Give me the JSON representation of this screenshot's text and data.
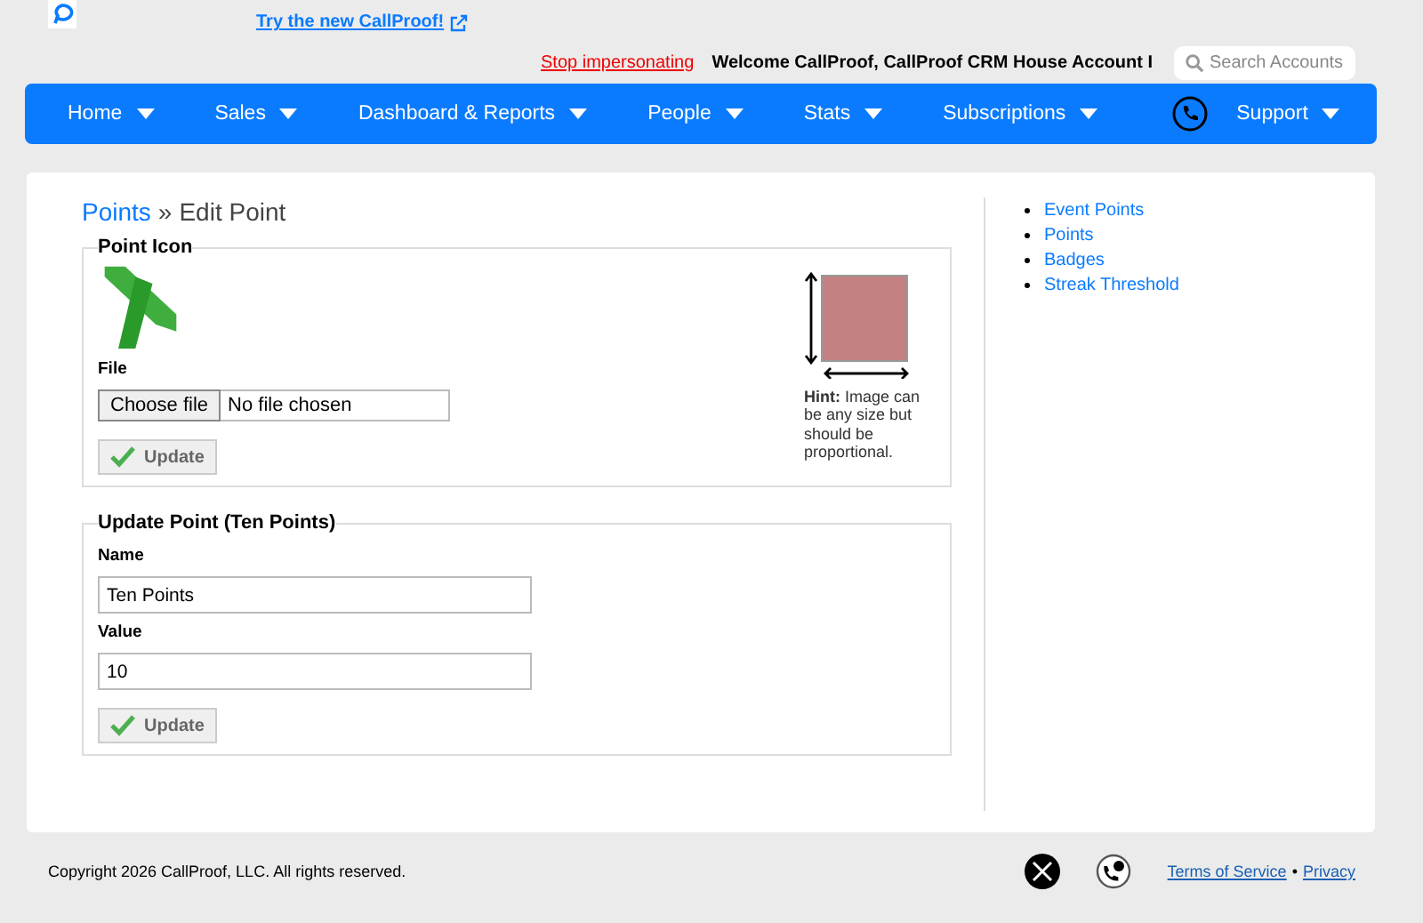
{
  "top_link": "Try the new CallProof!",
  "stop_link": "Stop impersonating",
  "welcome": "Welcome CallProof, CallProof CRM House Account I",
  "search": {
    "placeholder": "Search Accounts"
  },
  "nav": [
    {
      "label": "Home"
    },
    {
      "label": "Sales"
    },
    {
      "label": "Dashboard & Reports"
    },
    {
      "label": "People"
    },
    {
      "label": "Stats"
    },
    {
      "label": "Subscriptions"
    },
    {
      "label": "Support",
      "kind": "phone"
    }
  ],
  "breadcrumb": {
    "link": "Points",
    "separator": "»",
    "current": "Edit Point"
  },
  "icon_section": {
    "legend": "Point Icon",
    "file_label": "File",
    "file_button": "Choose file",
    "file_status": "No file chosen",
    "update": "Update",
    "hint": "**Hint:** Image can be any size but should be proportional."
  },
  "update_section": {
    "legend": "Update Point (Ten Points)",
    "fields": [
      {
        "label": "Name",
        "value": "Ten Points"
      },
      {
        "label": "Value",
        "value": "10"
      }
    ],
    "update": "Update"
  },
  "sidebar": [
    "Event Points",
    "Points",
    "Badges",
    "Streak Threshold"
  ],
  "footer": {
    "copyright": "Copyright 2026 CallProof, LLC. All rights reserved.",
    "links": [
      "Terms of Service",
      "Privacy"
    ],
    "separator": "•"
  }
}
